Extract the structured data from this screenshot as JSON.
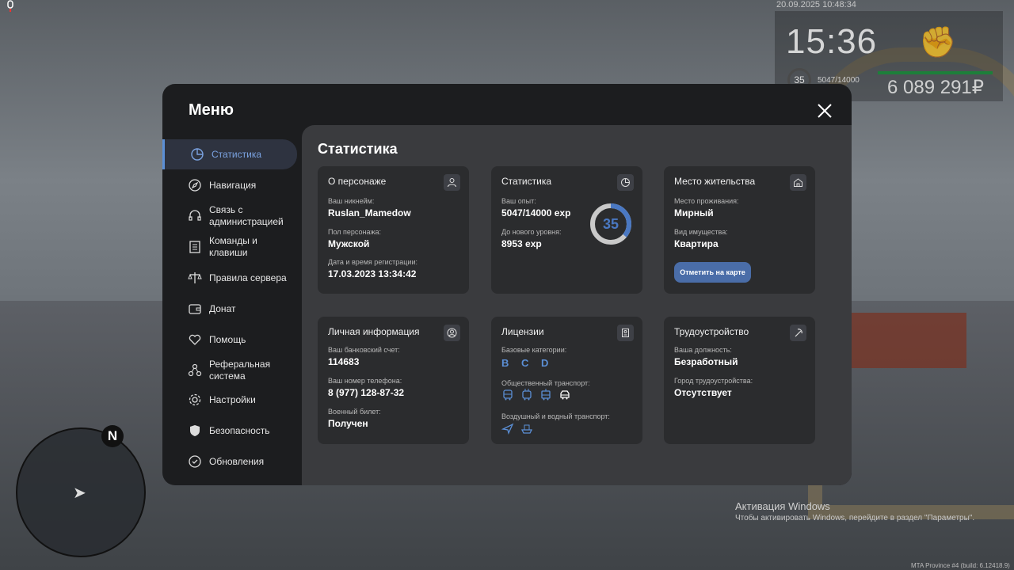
{
  "hud": {
    "datetime": "20.09.2025 10:48:34",
    "time": "15:36",
    "level": "35",
    "exp": "5047/14000",
    "money": "6 089 291₽",
    "fist_icon": "fist-icon",
    "mic_icon": "microphone-icon"
  },
  "menu": {
    "title": "Меню",
    "content_title": "Статистика"
  },
  "sidebar": {
    "items": [
      {
        "label": "Статистика",
        "icon": "pie-chart-icon"
      },
      {
        "label": "Навигация",
        "icon": "compass-icon"
      },
      {
        "label": "Связь с администрацией",
        "icon": "headset-icon"
      },
      {
        "label": "Команды и клавиши",
        "icon": "document-icon"
      },
      {
        "label": "Правила сервера",
        "icon": "scales-icon"
      },
      {
        "label": "Донат",
        "icon": "wallet-icon"
      },
      {
        "label": "Помощь",
        "icon": "heart-hand-icon"
      },
      {
        "label": "Реферальная система",
        "icon": "network-icon"
      },
      {
        "label": "Настройки",
        "icon": "gear-icon"
      },
      {
        "label": "Безопасность",
        "icon": "shield-icon"
      },
      {
        "label": "Обновления",
        "icon": "refresh-check-icon"
      }
    ]
  },
  "cards": {
    "character": {
      "title": "О персонаже",
      "nick_label": "Ваш никнейм:",
      "nick": "Ruslan_Mamedow",
      "gender_label": "Пол персонажа:",
      "gender": "Мужской",
      "reg_label": "Дата и время регистрации:",
      "reg": "17.03.2023 13:34:42"
    },
    "stats": {
      "title": "Статистика",
      "exp_label": "Ваш опыт:",
      "exp": "5047/14000 exp",
      "next_label": "До нового уровня:",
      "next": "8953 exp",
      "level": "35",
      "progress": 0.3605
    },
    "residence": {
      "title": "Место жительства",
      "place_label": "Место проживания:",
      "place": "Мирный",
      "property_label": "Вид имущества:",
      "property": "Квартира",
      "button": "Отметить на карте"
    },
    "personal": {
      "title": "Личная информация",
      "bank_label": "Ваш банковский счет:",
      "bank": "114683",
      "phone_label": "Ваш номер телефона:",
      "phone": "8 (977) 128-87-32",
      "military_label": "Военный билет:",
      "military": "Получен"
    },
    "licenses": {
      "title": "Лицензии",
      "base_label": "Базовые категории:",
      "base": "B C D",
      "public_label": "Общественный транспорт:",
      "air_label": "Воздушный и водный транспорт:"
    },
    "job": {
      "title": "Трудоустройство",
      "position_label": "Ваша должность:",
      "position": "Безработный",
      "city_label": "Город трудоустройства:",
      "city": "Отсутствует"
    }
  },
  "radar": {
    "north": "N"
  },
  "watermark": {
    "title": "Активация Windows",
    "subtitle": "Чтобы активировать Windows, перейдите в раздел \"Параметры\"."
  },
  "build": "MTA Province #4 (build: 6.12418.9)",
  "colors": {
    "accent": "#5b8fd6",
    "menu_bg": "#1c1d1f",
    "content_bg": "#3a3b3e",
    "card_bg": "#2b2c2e",
    "money_bar": "#1d7f3a"
  }
}
